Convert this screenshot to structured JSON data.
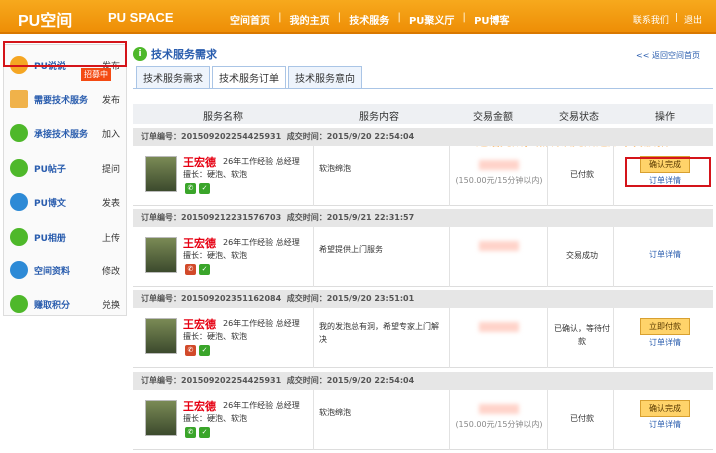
{
  "header": {
    "logo": "PU空间",
    "logo_sub": "PU SPACE",
    "nav": [
      "空间首页",
      "我的主页",
      "技术服务",
      "PU聚义厅",
      "PU博客"
    ],
    "right": [
      "联系我们",
      "退出"
    ]
  },
  "sidebar": {
    "items": [
      {
        "label": "PU说说",
        "action": "发布",
        "icon": "speech-icon",
        "color": "#f5a623"
      },
      {
        "label": "需要技术服务",
        "action": "发布",
        "icon": "folder-icon",
        "color": "#f0b24a"
      },
      {
        "label": "承接技术服务",
        "action": "加入",
        "icon": "info-icon",
        "color": "#4eb82a"
      },
      {
        "label": "PU帖子",
        "action": "提问",
        "icon": "post-icon",
        "color": "#4eb82a"
      },
      {
        "label": "PU博文",
        "action": "发表",
        "icon": "blog-icon",
        "color": "#2d8ad6"
      },
      {
        "label": "PU相册",
        "action": "上传",
        "icon": "album-icon",
        "color": "#4eb82a"
      },
      {
        "label": "空间资料",
        "action": "修改",
        "icon": "home-icon",
        "color": "#2d8ad6"
      },
      {
        "label": "赚取积分",
        "action": "兑换",
        "icon": "points-icon",
        "color": "#4eb82a"
      }
    ],
    "hire_badge": "招募中"
  },
  "main": {
    "title": "技术服务需求",
    "back": "<< 返回空间首页",
    "tabs": [
      "技术服务需求",
      "技术服务订单",
      "技术服务意向"
    ],
    "columns": [
      "服务名称",
      "服务内容",
      "交易金额",
      "交易状态",
      "操作"
    ],
    "annotation": "通话完成，点确认完成通知平台放款",
    "orders": [
      {
        "no": "订单编号：2015092022544259​31",
        "time": "成交时间：2015/9/20 22:54:04",
        "name": "王宏德",
        "exp": "26年工作经验 总经理",
        "skill": "擅长：硬泡、软泡",
        "content": "软泡绵泡",
        "amount_note": "(150.00元/15分钟以内)",
        "status": "已付款",
        "button": "确认完成",
        "link": "订单详情"
      },
      {
        "no": "订单编号：20150921223​1576703",
        "time": "成交时间：2015/9/21 22:31:57",
        "name": "王宏德",
        "exp": "26年工作经验 总经理",
        "skill": "擅长：硬泡、软泡",
        "content": "希望提供上门服务",
        "amount_note": "",
        "status": "交易成功",
        "button": "",
        "link": "订单详情"
      },
      {
        "no": "订单编号：201509202351162084",
        "time": "成交时间：2015/9/20 23:51:01",
        "name": "王宏德",
        "exp": "26年工作经验 总经理",
        "skill": "擅长：硬泡、软泡",
        "content": "我的发泡总有洞，希望专家上门解决",
        "amount_note": "",
        "status": "已确认，等待付款",
        "button": "立即付款",
        "link": "订单详情"
      },
      {
        "no": "订单编号：20150920225​44259​31",
        "time": "成交时间：2015/9/20 22:54:04",
        "name": "王宏德",
        "exp": "26年工作经验 总经理",
        "skill": "擅长：硬泡、软泡",
        "content": "软泡绵泡",
        "amount_note": "(150.00元/15分钟以内)",
        "status": "已付款",
        "button": "确认完成",
        "link": "订单详情"
      }
    ]
  }
}
